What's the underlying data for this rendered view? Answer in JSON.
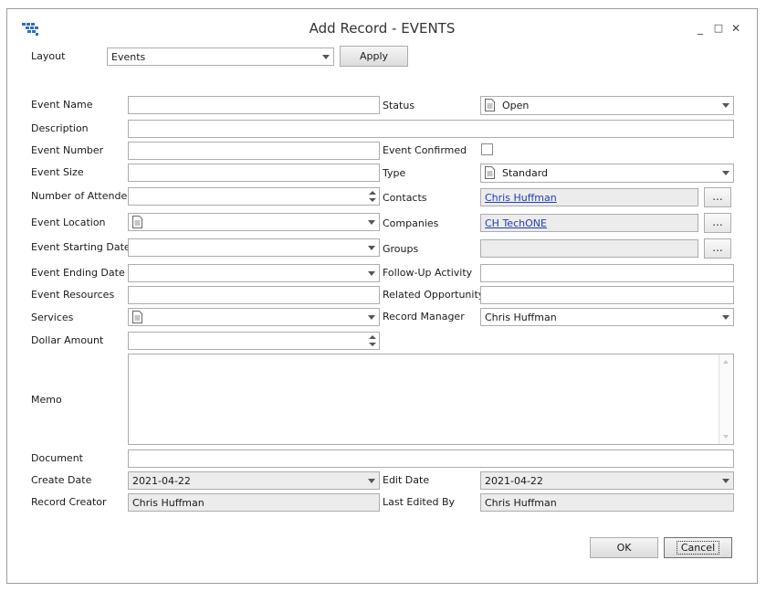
{
  "window": {
    "title": "Add Record - EVENTS",
    "minimize_glyph": "_",
    "maximize_glyph": "□",
    "close_glyph": "✕"
  },
  "layout": {
    "label": "Layout",
    "value": "Events",
    "apply_label": "Apply"
  },
  "fields": {
    "event_name": {
      "label": "Event Name",
      "value": ""
    },
    "description": {
      "label": "Description",
      "value": ""
    },
    "event_number": {
      "label": "Event Number",
      "value": ""
    },
    "event_size": {
      "label": "Event Size",
      "value": ""
    },
    "number_of_attendees": {
      "label": "Number of Attendees",
      "value": ""
    },
    "event_location": {
      "label": "Event Location",
      "value": ""
    },
    "event_starting_date": {
      "label": "Event Starting Date",
      "value": ""
    },
    "event_ending_date": {
      "label": "Event Ending Date",
      "value": ""
    },
    "event_resources": {
      "label": "Event Resources",
      "value": ""
    },
    "services": {
      "label": "Services",
      "value": ""
    },
    "dollar_amount": {
      "label": "Dollar Amount",
      "value": ""
    },
    "memo": {
      "label": "Memo",
      "value": ""
    },
    "document": {
      "label": "Document",
      "value": ""
    },
    "create_date": {
      "label": "Create Date",
      "value": "2021-04-22"
    },
    "record_creator": {
      "label": "Record Creator",
      "value": "Chris Huffman"
    },
    "status": {
      "label": "Status",
      "value": "Open"
    },
    "event_confirmed": {
      "label": "Event Confirmed",
      "checked": false
    },
    "type": {
      "label": "Type",
      "value": "Standard"
    },
    "contacts": {
      "label": "Contacts",
      "value": "Chris Huffman"
    },
    "companies": {
      "label": "Companies",
      "value": "CH TechONE"
    },
    "groups": {
      "label": "Groups",
      "value": ""
    },
    "follow_up_activity": {
      "label": "Follow-Up Activity",
      "value": ""
    },
    "related_opportunity": {
      "label": "Related Opportunity",
      "value": ""
    },
    "record_manager": {
      "label": "Record Manager",
      "value": "Chris Huffman"
    },
    "edit_date": {
      "label": "Edit Date",
      "value": "2021-04-22"
    },
    "last_edited_by": {
      "label": "Last Edited By",
      "value": "Chris Huffman"
    }
  },
  "lookup_button_label": "...",
  "buttons": {
    "ok_label": "OK",
    "cancel_label": "Cancel"
  },
  "icons": {
    "app": "grid-table-icon",
    "document": "document-icon",
    "dropdown": "chevron-down-icon",
    "spinner": "spinner-arrows-icon"
  },
  "colors": {
    "link": "#1d3fb3",
    "readonly_bg": "#ececec",
    "border": "#adadad",
    "app_icon": "#2f6fc0"
  }
}
